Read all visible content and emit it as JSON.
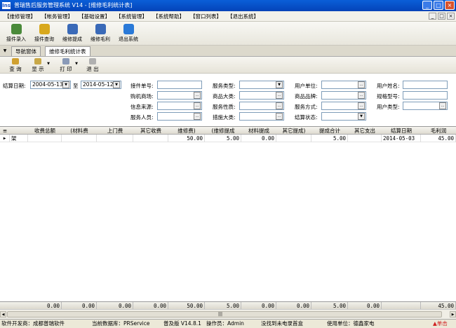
{
  "window": {
    "title": "普瑞售后服务管理系统 V14 - [维修毛利统计表]",
    "app_icon_text": "Ins",
    "min": "_",
    "max": "□",
    "close": "×"
  },
  "menu": {
    "items": [
      "【维修管理】",
      "【帐务管理】",
      "【基础设置】",
      "【系统管理】",
      "【系统帮助】",
      "【窗口列表】",
      "【退出系统】"
    ],
    "mdi_min": "_",
    "mdi_max": "□",
    "mdi_close": "×"
  },
  "toolbar": {
    "buttons": [
      {
        "label": "接件录入",
        "color": "#4a8a3a"
      },
      {
        "label": "接件查询",
        "color": "#d8a81c"
      },
      {
        "label": "维修提成",
        "color": "#3a6ab8"
      },
      {
        "label": "维修毛利",
        "color": "#3a6ab8"
      },
      {
        "label": "退出系统",
        "color": "#2a7ad8"
      }
    ]
  },
  "tabs": {
    "arrow": "▼",
    "items": [
      "导航窗体",
      "维修毛利统计表"
    ]
  },
  "actions": {
    "query": "查 询",
    "display": "显 示",
    "print": "打 印",
    "exit": "退 出",
    "dropdown": "▼"
  },
  "filters": {
    "settle_date_label": "结算日期:",
    "date_from": "2004-05-13",
    "date_to": "2014-05-12",
    "to_label": "至",
    "col2_labels": [
      "接件单号:",
      "购机商场:",
      "信息来源:",
      "服务人员:"
    ],
    "col3_labels": [
      "服务类型:",
      "商品大类:",
      "服务性质:",
      "措施大类:"
    ],
    "col4_labels": [
      "用户单位:",
      "商品品牌:",
      "服务方式:",
      "结算状态:"
    ],
    "col5_labels": [
      "用户姓名:",
      "规格型号:",
      "用户类型:"
    ],
    "dd_icon": "▼",
    "ellipsis_icon": "..."
  },
  "grid": {
    "headers": [
      "收费总额",
      "(材料费",
      "上门费",
      "其它收费",
      "维修费)",
      "(维修提成",
      "材料提成",
      "其它提成)",
      "提成合计",
      "其它支出",
      "结算日期",
      "毛利润"
    ],
    "rowhead": "架",
    "rows": [
      [
        "",
        "",
        "",
        "",
        "50.00",
        "5.00",
        "0.00",
        "",
        "5.00",
        "",
        "2014-05-03",
        "45.00"
      ]
    ],
    "totals": [
      "0.00",
      "0.00",
      "0.00",
      "0.00",
      "50.00",
      "5.00",
      "0.00",
      "0.00",
      "5.00",
      "0.00",
      "",
      "45.00"
    ]
  },
  "status": {
    "developer": "软件开发商：成都普瑞软件",
    "database": "当前数据库：PRService",
    "version": "普及版 V14.8.1",
    "operator": "操作员：Admin",
    "message": "没找到未电录首盒",
    "unit": "使用单位：德鑫家电",
    "alert": "▲单击"
  }
}
